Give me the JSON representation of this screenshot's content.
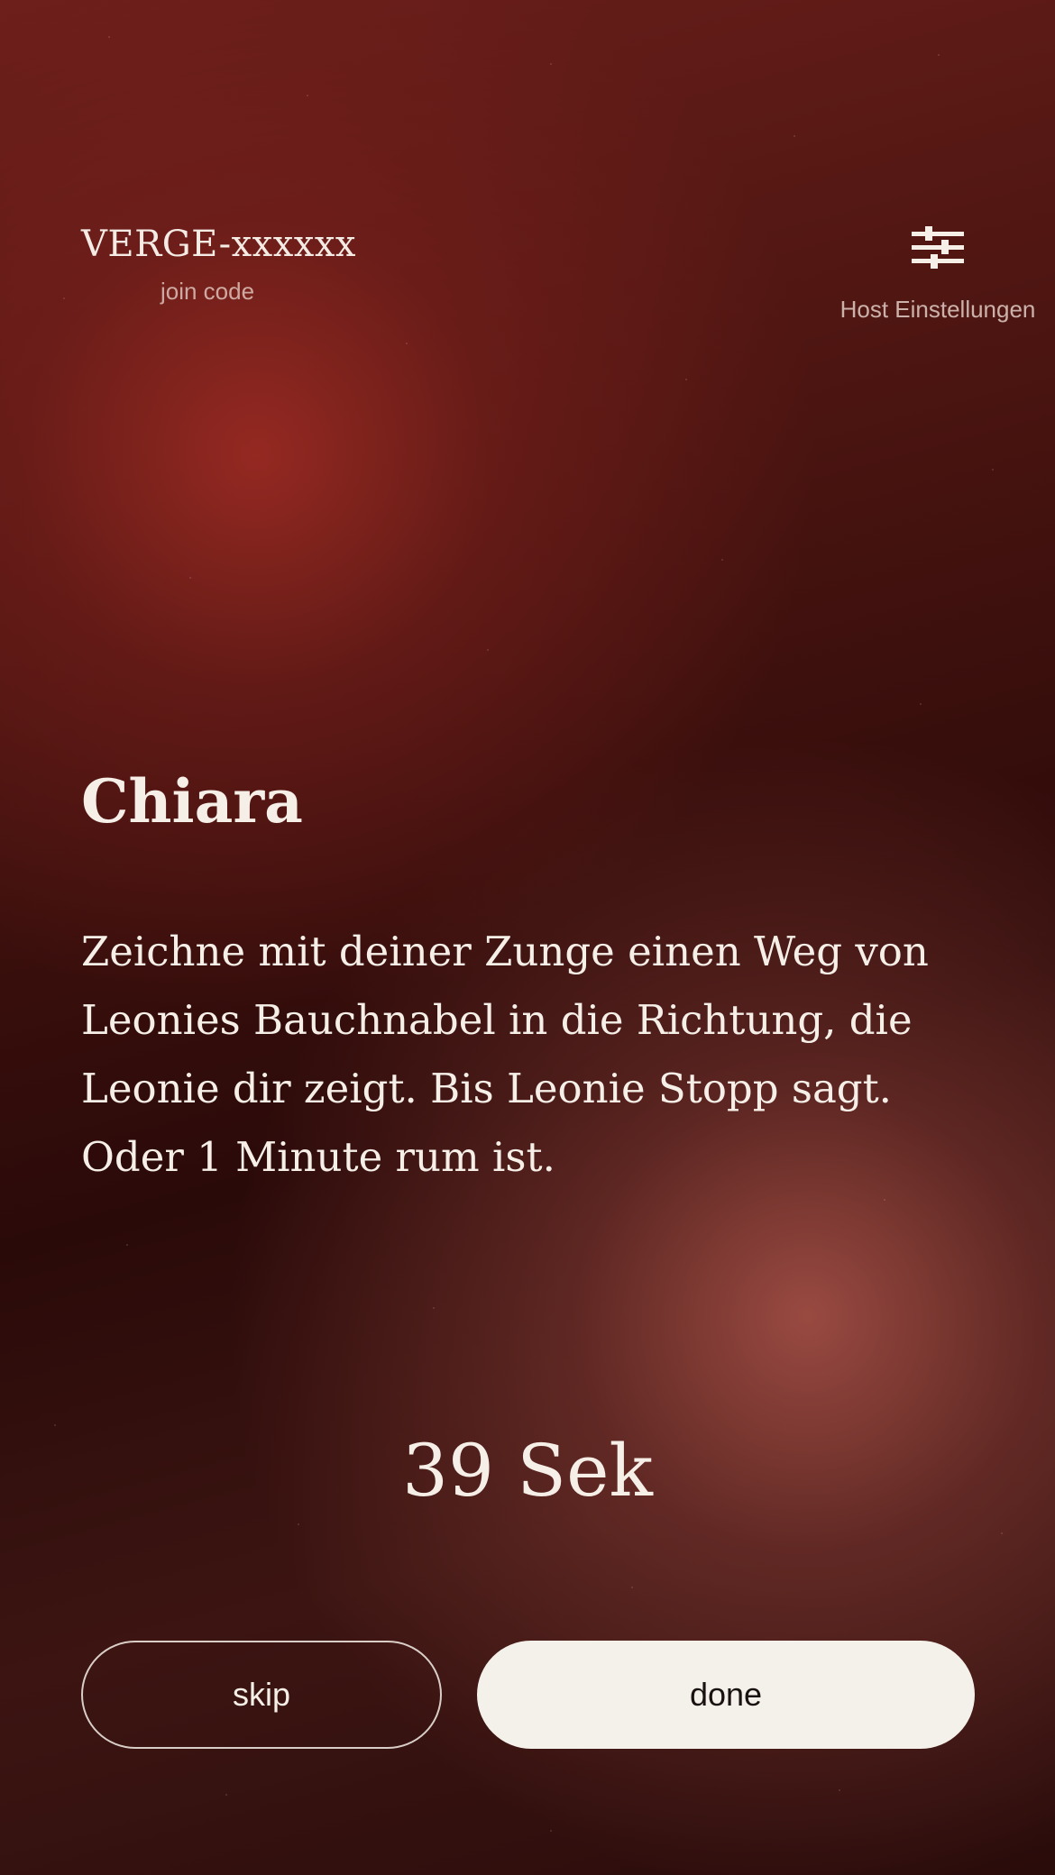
{
  "header": {
    "join_code": "VERGE-xxxxxx",
    "join_code_label": "join code",
    "host_settings_label": "Host Einstellungen",
    "host_settings_icon": "sliders-icon"
  },
  "card": {
    "player_name": "Chiara",
    "task_text": "Zeichne mit deiner Zunge einen Weg von Leonies Bauchnabel in die Richtung, die Leonie dir zeigt. Bis Leonie Stopp sagt. Oder 1 Minute rum ist."
  },
  "timer": {
    "display": "39 Sek"
  },
  "actions": {
    "skip_label": "skip",
    "done_label": "done"
  },
  "colors": {
    "background_dark": "#1e0808",
    "glow_red": "#a02c24",
    "glow_rose": "#aa544a",
    "text_light": "#f6efe8",
    "done_button_fill": "#f4f1ea"
  }
}
